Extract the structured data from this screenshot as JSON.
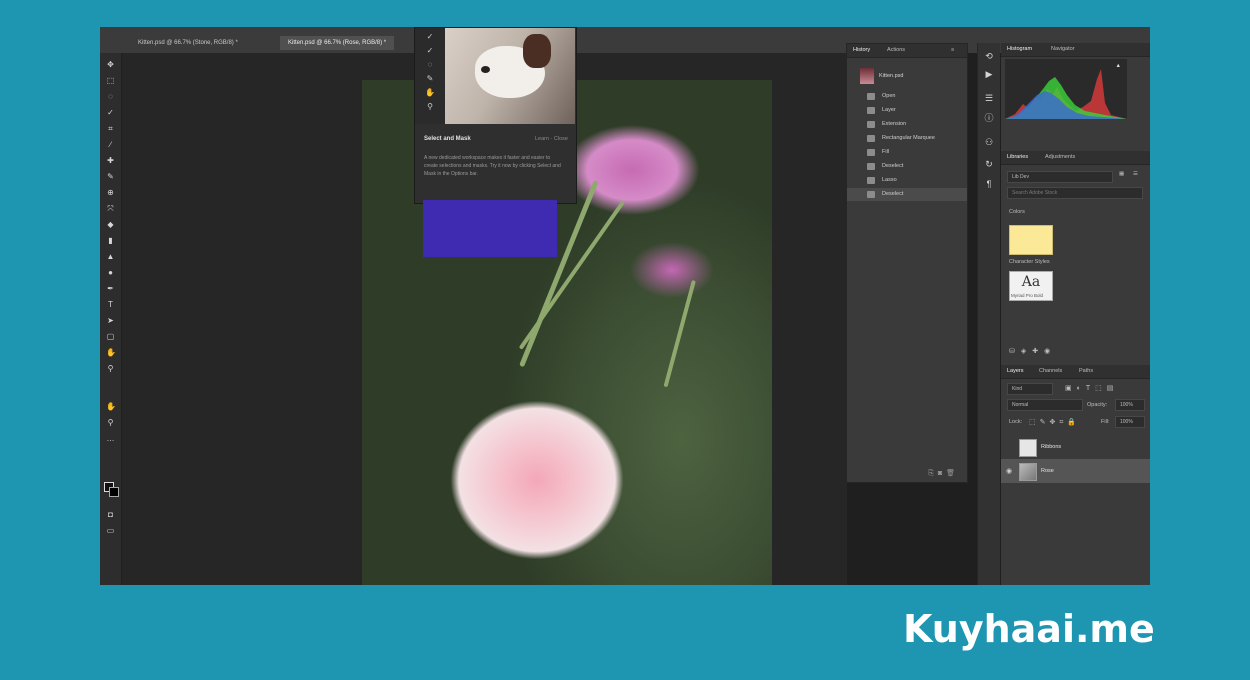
{
  "document_tabs": [
    "Kitten.psd @ 66.7% (Stone, RGB/8) *",
    "Kitten.psd @ 66.7% (Rose, RGB/8) *"
  ],
  "tooltip": {
    "title": "Select and Mask",
    "links": "Learn · Close",
    "description": "A new dedicated workspace makes it faster and easier to create selections and masks. Try it now by clicking Select and Mask in the Options bar."
  },
  "history_panel": {
    "tabs": [
      "History",
      "Actions"
    ],
    "snapshot_label": "Kitten.psd",
    "items": [
      "Open",
      "Layer",
      "Extension",
      "Rectangular Marquee",
      "Fill",
      "Deselect",
      "Lasso",
      "Deselect"
    ]
  },
  "histogram_panel": {
    "tabs": [
      "Histogram",
      "Navigator"
    ]
  },
  "libraries_panel": {
    "tabs": [
      "Libraries",
      "Adjustments"
    ],
    "library_select": "Lib Dev",
    "search_placeholder": "Search Adobe Stock",
    "colors_heading": "Colors",
    "character_styles_heading": "Character Styles",
    "swatch_color": "#fbe998",
    "char_style_sample": "Aa",
    "char_style_caption": "Myriad Pro Bold"
  },
  "layers_panel": {
    "tabs": [
      "Layers",
      "Channels",
      "Paths"
    ],
    "filter": "Kind",
    "blend_mode": "Normal",
    "opacity_label": "Opacity:",
    "opacity_value": "100%",
    "lock_label": "Lock:",
    "fill_label": "Fill:",
    "fill_value": "100%",
    "layers": [
      {
        "name": "Ribbons",
        "visible": false
      },
      {
        "name": "Rose",
        "visible": true
      }
    ]
  },
  "watermark": "Kuyhaai.me",
  "colors": {
    "page_background": "#1e95b1",
    "tooltip_accent_box": "#3f2bb2"
  }
}
